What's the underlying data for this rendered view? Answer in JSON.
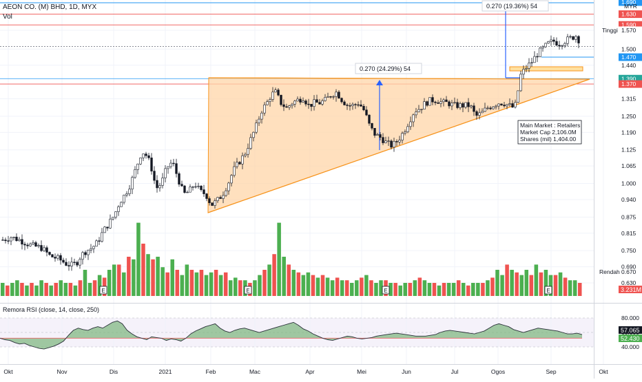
{
  "header": {
    "symbol_line": "AEON CO. (M) BHD, 1D, MYX",
    "vol_label": "Vol",
    "rsi_label": "Remora RSI (close, 14, close, 250)"
  },
  "colors": {
    "up": "#26a69a",
    "down": "#ef5350",
    "vol_up": "#4caf50",
    "vol_down": "#ef5350",
    "triangle_fill": "#ffd6a8",
    "triangle_edge": "#f7941d",
    "measure": "#2962ff",
    "rsi_fill": "#7bb57b",
    "rsi_line": "#2a2e39",
    "rsi_signal": "#e57373",
    "resistance_red": "#ef5350",
    "support_blue": "#2196f3",
    "grid": "#f0f3fa"
  },
  "chart_data": {
    "type": "candlestick",
    "price_axis": {
      "currency": "MYR",
      "ticks": [
        "1.570",
        "1.500",
        "1.440",
        "1.315",
        "1.250",
        "1.190",
        "1.125",
        "1.065",
        "1.000",
        "0.940",
        "0.875",
        "0.815",
        "0.750",
        "0.690",
        "0.630"
      ],
      "ylim": [
        0.6,
        1.7
      ]
    },
    "x_axis": {
      "ticks": [
        "Okt",
        "Nov",
        "Dis",
        "2021",
        "Feb",
        "Mac",
        "Apr",
        "Mei",
        "Jun",
        "Jul",
        "Ogos",
        "Sep",
        "Okt"
      ]
    },
    "price_labels": [
      {
        "text": "1.630",
        "style": "red"
      },
      {
        "text": "1.590",
        "style": "red"
      },
      {
        "text": "1.570",
        "style": "plain"
      },
      {
        "text": "1.470",
        "style": "blue"
      },
      {
        "text": "1.390",
        "style": "teal"
      },
      {
        "text": "1.370",
        "style": "red"
      },
      {
        "text": "1.690",
        "style": "blue"
      }
    ],
    "high_label": {
      "text": "Tinggi",
      "value": "1.570"
    },
    "low_label": {
      "text": "Rendah",
      "value": "0.670"
    },
    "volume_label": "3.231M",
    "measurements": [
      {
        "text": "0.270 (24.29%) 54"
      },
      {
        "text": "0.270 (19.36%) 54"
      }
    ],
    "info_box": [
      "Main Market : Retailers",
      "Market Cap 2,106.0M",
      "Shares (mil) 1,404.00"
    ],
    "earnings_marker": "E",
    "rsi": {
      "ticks": [
        "80.000",
        "60.000",
        "40.000"
      ],
      "value_label": "57.065",
      "signal_label": "52.430"
    },
    "price_path": [
      [
        0,
        0.79
      ],
      [
        6,
        0.8
      ],
      [
        12,
        0.79
      ],
      [
        20,
        0.77
      ],
      [
        28,
        0.76
      ],
      [
        34,
        0.73
      ],
      [
        40,
        0.72
      ],
      [
        46,
        0.7
      ],
      [
        50,
        0.695
      ],
      [
        54,
        0.71
      ],
      [
        56,
        0.73
      ],
      [
        60,
        0.75
      ],
      [
        64,
        0.76
      ],
      [
        68,
        0.78
      ],
      [
        72,
        0.82
      ],
      [
        76,
        0.85
      ],
      [
        80,
        0.88
      ],
      [
        84,
        0.93
      ],
      [
        88,
        0.96
      ],
      [
        92,
        1.0
      ],
      [
        96,
        1.06
      ],
      [
        100,
        1.12
      ],
      [
        104,
        1.1
      ],
      [
        108,
        1.04
      ],
      [
        110,
        0.98
      ],
      [
        114,
        1.0
      ],
      [
        118,
        1.06
      ],
      [
        122,
        1.08
      ],
      [
        126,
        1.02
      ],
      [
        130,
        0.96
      ],
      [
        134,
        0.97
      ],
      [
        138,
        1.0
      ],
      [
        142,
        0.97
      ],
      [
        146,
        0.96
      ],
      [
        150,
        0.92
      ],
      [
        154,
        0.935
      ],
      [
        158,
        0.96
      ],
      [
        162,
        1.0
      ],
      [
        166,
        1.05
      ],
      [
        170,
        1.08
      ],
      [
        174,
        1.11
      ],
      [
        178,
        1.16
      ],
      [
        182,
        1.21
      ],
      [
        186,
        1.27
      ],
      [
        190,
        1.3
      ],
      [
        193,
        1.33
      ],
      [
        196,
        1.34
      ],
      [
        200,
        1.3
      ],
      [
        204,
        1.28
      ],
      [
        208,
        1.3
      ],
      [
        212,
        1.31
      ],
      [
        216,
        1.32
      ],
      [
        220,
        1.29
      ],
      [
        224,
        1.3
      ],
      [
        228,
        1.3
      ],
      [
        232,
        1.31
      ],
      [
        236,
        1.33
      ],
      [
        240,
        1.34
      ],
      [
        244,
        1.31
      ],
      [
        248,
        1.29
      ],
      [
        252,
        1.29
      ],
      [
        256,
        1.3
      ],
      [
        260,
        1.27
      ],
      [
        264,
        1.21
      ],
      [
        268,
        1.18
      ],
      [
        272,
        1.17
      ],
      [
        276,
        1.15
      ],
      [
        280,
        1.14
      ],
      [
        284,
        1.16
      ],
      [
        288,
        1.19
      ],
      [
        292,
        1.23
      ],
      [
        296,
        1.27
      ],
      [
        300,
        1.28
      ],
      [
        304,
        1.3
      ],
      [
        308,
        1.31
      ],
      [
        312,
        1.31
      ],
      [
        316,
        1.3
      ],
      [
        320,
        1.3
      ],
      [
        324,
        1.29
      ],
      [
        328,
        1.29
      ],
      [
        332,
        1.29
      ],
      [
        336,
        1.29
      ],
      [
        340,
        1.25
      ],
      [
        344,
        1.26
      ],
      [
        348,
        1.28
      ],
      [
        352,
        1.29
      ],
      [
        356,
        1.3
      ],
      [
        360,
        1.3
      ],
      [
        364,
        1.29
      ],
      [
        368,
        1.28
      ],
      [
        370,
        1.33
      ],
      [
        372,
        1.4
      ],
      [
        376,
        1.43
      ],
      [
        380,
        1.45
      ],
      [
        384,
        1.48
      ],
      [
        388,
        1.5
      ],
      [
        392,
        1.52
      ],
      [
        396,
        1.53
      ],
      [
        400,
        1.52
      ],
      [
        404,
        1.53
      ],
      [
        408,
        1.54
      ],
      [
        412,
        1.55
      ],
      [
        416,
        1.52
      ]
    ],
    "volume_bars": [
      0.05,
      0.04,
      0.05,
      0.06,
      0.05,
      0.04,
      0.05,
      0.04,
      0.06,
      0.05,
      0.04,
      0.05,
      0.06,
      0.05,
      0.05,
      0.04,
      0.06,
      0.1,
      0.05,
      0.06,
      0.08,
      0.07,
      0.1,
      0.12,
      0.12,
      0.09,
      0.15,
      0.14,
      0.28,
      0.2,
      0.16,
      0.14,
      0.15,
      0.11,
      0.09,
      0.14,
      0.1,
      0.08,
      0.12,
      0.1,
      0.09,
      0.1,
      0.08,
      0.09,
      0.1,
      0.08,
      0.09,
      0.06,
      0.07,
      0.06,
      0.06,
      0.05,
      0.06,
      0.08,
      0.1,
      0.12,
      0.16,
      0.28,
      0.15,
      0.12,
      0.1,
      0.09,
      0.08,
      0.09,
      0.08,
      0.07,
      0.08,
      0.07,
      0.06,
      0.07,
      0.06,
      0.06,
      0.05,
      0.06,
      0.07,
      0.08,
      0.06,
      0.05,
      0.06,
      0.06,
      0.05,
      0.05,
      0.04,
      0.05,
      0.05,
      0.06,
      0.07,
      0.06,
      0.05,
      0.05,
      0.04,
      0.05,
      0.05,
      0.05,
      0.06,
      0.05,
      0.04,
      0.05,
      0.05,
      0.05,
      0.06,
      0.07,
      0.1,
      0.08,
      0.12,
      0.1,
      0.09,
      0.08,
      0.1,
      0.08,
      0.12,
      0.09,
      0.1,
      0.08,
      0.08,
      0.09,
      0.07,
      0.06,
      0.06,
      0.05
    ],
    "rsi_series": [
      52,
      50,
      49,
      46,
      44,
      45,
      42,
      40,
      38,
      37,
      39,
      41,
      44,
      48,
      56,
      63,
      66,
      64,
      63,
      66,
      68,
      66,
      70,
      74,
      76,
      72,
      63,
      58,
      54,
      52,
      50,
      54,
      53,
      52,
      49,
      51,
      50,
      48,
      52,
      58,
      62,
      65,
      68,
      70,
      72,
      66,
      62,
      60,
      63,
      65,
      66,
      64,
      62,
      60,
      62,
      64,
      66,
      68,
      70,
      72,
      74,
      70,
      65,
      62,
      58,
      55,
      52,
      50,
      49,
      51,
      53,
      55,
      54,
      52,
      51,
      52,
      53,
      55,
      56,
      57,
      58,
      59,
      58,
      57,
      56,
      55,
      55,
      55,
      56,
      57,
      60,
      62,
      63,
      62,
      61,
      60,
      59,
      58,
      60,
      62,
      66,
      70,
      72,
      70,
      68,
      64,
      62,
      60,
      62,
      64,
      66,
      65,
      64,
      63,
      62,
      60,
      58,
      58,
      59,
      57
    ]
  }
}
